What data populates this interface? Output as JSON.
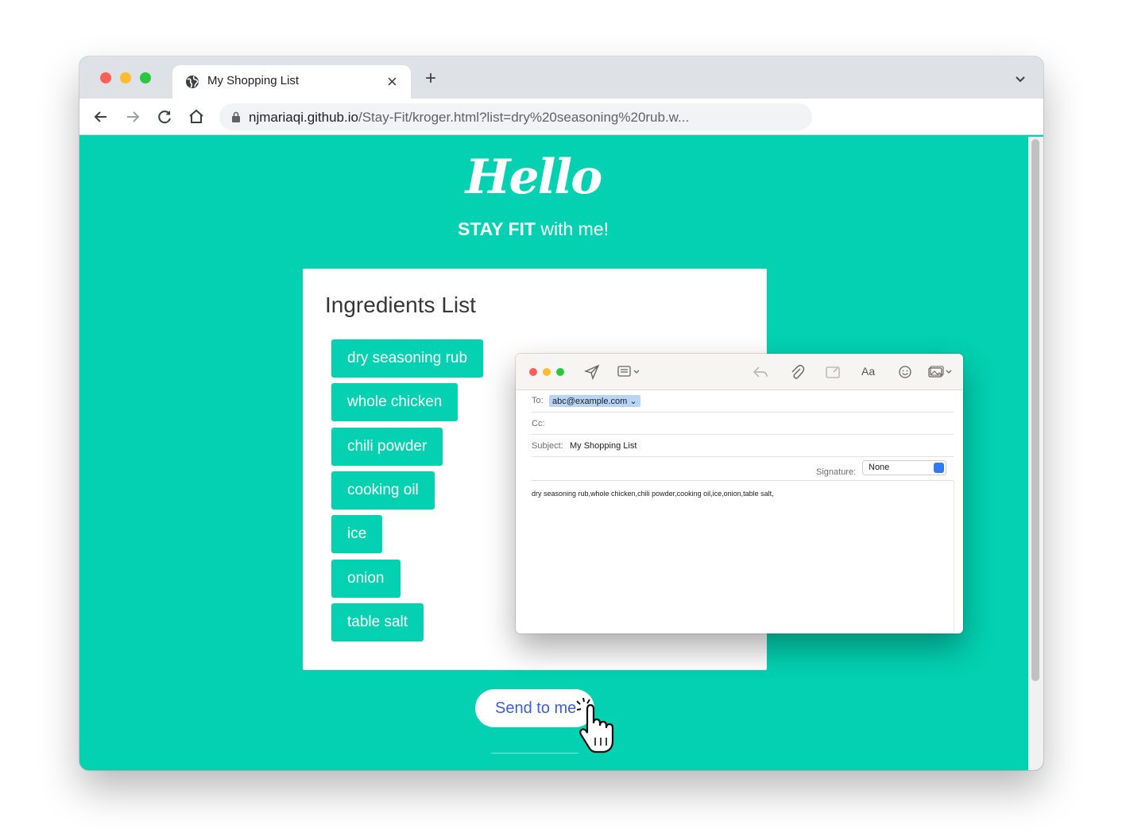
{
  "browser": {
    "tab_title": "My Shopping List",
    "url_host": "njmariaqi.github.io",
    "url_rest": "/Stay-Fit/kroger.html?list=dry%20seasoning%20rub.w..."
  },
  "page": {
    "hello": "Hello",
    "tagline_bold": "STAY FIT",
    "tagline_rest": " with me!",
    "card_title": "Ingredients List",
    "ingredients": [
      "dry seasoning rub",
      "whole chicken",
      "chili powder",
      "cooking oil",
      "ice",
      "onion",
      "table salt"
    ],
    "send_button": "Send to me"
  },
  "mail": {
    "to_label": "To:",
    "to_value": "abc@example.com",
    "cc_label": "Cc:",
    "subject_label": "Subject:",
    "subject_value": "My Shopping List",
    "format_label": "Aa",
    "signature_label": "Signature:",
    "signature_value": "None",
    "body": "dry seasoning rub,whole chicken,chili powder,cooking oil,ice,onion,table salt,"
  },
  "colors": {
    "accent": "#03d1b1",
    "link_blue": "#3b5fd6"
  }
}
